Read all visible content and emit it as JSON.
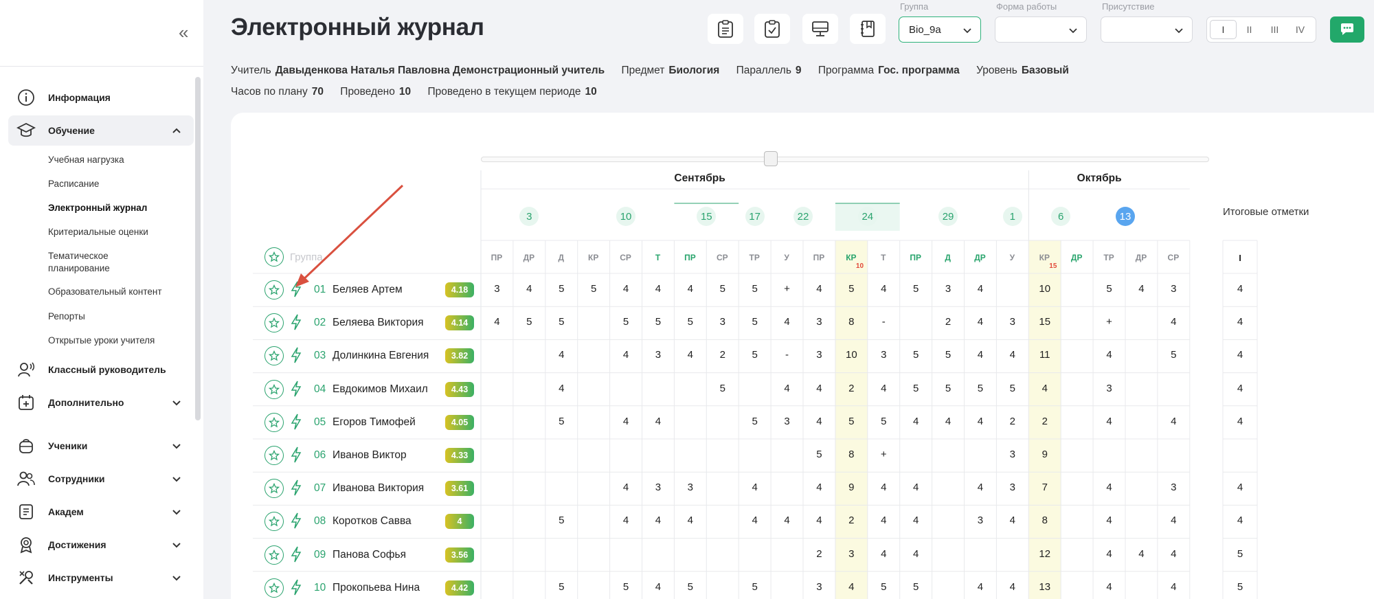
{
  "sidebar": {
    "items": [
      {
        "id": "info",
        "label": "Информация",
        "icon": "info-circle-icon",
        "expandable": false
      },
      {
        "id": "learning",
        "label": "Обучение",
        "icon": "graduation-cap-icon",
        "expandable": true,
        "expanded": true
      },
      {
        "id": "class-teacher",
        "label": "Классный руководитель",
        "icon": "person-voice-icon",
        "expandable": false
      },
      {
        "id": "extra",
        "label": "Дополнительно",
        "icon": "calendar-plus-icon",
        "expandable": true
      },
      {
        "id": "students",
        "label": "Ученики",
        "icon": "backpack-icon",
        "expandable": true
      },
      {
        "id": "staff",
        "label": "Сотрудники",
        "icon": "people-icon",
        "expandable": true
      },
      {
        "id": "academ",
        "label": "Академ",
        "icon": "document-list-icon",
        "expandable": true
      },
      {
        "id": "achievements",
        "label": "Достижения",
        "icon": "medal-icon",
        "expandable": true
      },
      {
        "id": "tools",
        "label": "Инструменты",
        "icon": "tools-icon",
        "expandable": true
      }
    ],
    "sub_items": [
      {
        "label": "Учебная нагрузка",
        "active": false
      },
      {
        "label": "Расписание",
        "active": false
      },
      {
        "label": "Электронный журнал",
        "active": true
      },
      {
        "label": "Критериальные оценки",
        "active": false
      },
      {
        "label": "Тематическое\nпланирование",
        "active": false
      },
      {
        "label": "Образовательный контент",
        "active": false
      },
      {
        "label": "Репорты",
        "active": false
      },
      {
        "label": "Открытые уроки учителя",
        "active": false
      }
    ]
  },
  "header": {
    "title": "Электронный журнал",
    "tools": [
      "clipboard-list-icon",
      "clipboard-check-icon",
      "monitor-icon",
      "notebook-icon"
    ],
    "filters": {
      "group": {
        "label": "Группа",
        "value": "Bio_9a"
      },
      "work_form": {
        "label": "Форма работы",
        "value": ""
      },
      "presence": {
        "label": "Присутствие",
        "value": ""
      }
    },
    "periods": [
      "I",
      "II",
      "III",
      "IV"
    ],
    "active_period": "I",
    "chat_icon": "chat-icon"
  },
  "info": {
    "line1": [
      {
        "k": "Учитель",
        "v": "Давыденкова Наталья Павловна Демонстрационный учитель"
      },
      {
        "k": "Предмет",
        "v": "Биология"
      },
      {
        "k": "Параллель",
        "v": "9"
      },
      {
        "k": "Программа",
        "v": "Гос. программа"
      },
      {
        "k": "Уровень",
        "v": "Базовый"
      }
    ],
    "line2": [
      {
        "k": "Часов по плану",
        "v": "70"
      },
      {
        "k": "Проведено",
        "v": "10"
      },
      {
        "k": "Проведено в текущем периоде",
        "v": "10"
      }
    ]
  },
  "journal": {
    "group_placeholder": "Группа",
    "months": [
      {
        "name": "Сентябрь"
      },
      {
        "name": "Октябрь"
      }
    ],
    "final_title": "Итоговые отметки",
    "final_col": "I",
    "days": [
      {
        "d": "3",
        "span": 3
      },
      {
        "d": "10",
        "span": 3
      },
      {
        "d": "15",
        "span": 2
      },
      {
        "d": "17",
        "span": 1
      },
      {
        "d": "22",
        "span": 2
      },
      {
        "d": "24",
        "span": 2
      },
      {
        "d": "29",
        "span": 3
      },
      {
        "d": "1",
        "span": 1
      },
      {
        "d": "6",
        "span": 2
      },
      {
        "d": "13",
        "span": 2
      }
    ],
    "columns": [
      {
        "h": "ПР",
        "g": false
      },
      {
        "h": "ДР",
        "g": false
      },
      {
        "h": "Д",
        "g": false
      },
      {
        "h": "КР",
        "g": false
      },
      {
        "h": "СР",
        "g": false
      },
      {
        "h": "Т",
        "g": true
      },
      {
        "h": "ПР",
        "g": true
      },
      {
        "h": "СР",
        "g": false
      },
      {
        "h": "ТР",
        "g": false
      },
      {
        "h": "У",
        "g": false
      },
      {
        "h": "ПР",
        "g": false
      },
      {
        "h": "КР",
        "g": true,
        "sub": "10"
      },
      {
        "h": "Т",
        "g": false
      },
      {
        "h": "ПР",
        "g": true
      },
      {
        "h": "Д",
        "g": true
      },
      {
        "h": "ДР",
        "g": true
      },
      {
        "h": "У",
        "g": false
      },
      {
        "h": "КР",
        "g": false,
        "sub": "15"
      },
      {
        "h": "ДР",
        "g": true
      },
      {
        "h": "ТР",
        "g": false
      },
      {
        "h": "ДР",
        "g": false
      },
      {
        "h": "СР",
        "g": false
      }
    ],
    "students": [
      {
        "n": "01",
        "name": "Беляев Артем",
        "avg": "4.18",
        "final": "4",
        "g": [
          "3",
          "4",
          "5",
          "5",
          "4",
          "4",
          "4",
          "5",
          "5",
          "+",
          "4",
          "5",
          "4",
          "5",
          "3",
          "4",
          "",
          "10",
          "",
          "5",
          "4",
          "3"
        ]
      },
      {
        "n": "02",
        "name": "Беляева Виктория",
        "avg": "4.14",
        "final": "4",
        "g": [
          "4",
          "5",
          "5",
          "",
          "5",
          "5",
          "5",
          "3",
          "5",
          "4",
          "3",
          "8",
          "-",
          "",
          "2",
          "4",
          "3",
          "15",
          "",
          "+",
          "",
          "4"
        ]
      },
      {
        "n": "03",
        "name": "Долинкина Евгения",
        "avg": "3.82",
        "final": "4",
        "g": [
          "",
          "",
          "4",
          "",
          "4",
          "3",
          "4",
          "2",
          "5",
          "-",
          "3",
          "10",
          "3",
          "5",
          "5",
          "4",
          "4",
          "11",
          "",
          "4",
          "",
          "5"
        ]
      },
      {
        "n": "04",
        "name": "Евдокимов Михаил",
        "avg": "4.43",
        "final": "4",
        "g": [
          "",
          "",
          "4",
          "",
          "",
          "",
          "",
          "5",
          "",
          "4",
          "4",
          "2",
          "4",
          "5",
          "5",
          "5",
          "5",
          "4",
          "",
          "3",
          "",
          ""
        ]
      },
      {
        "n": "05",
        "name": "Егоров Тимофей",
        "avg": "4.05",
        "final": "4",
        "g": [
          "",
          "",
          "5",
          "",
          "4",
          "4",
          "",
          "",
          "5",
          "3",
          "4",
          "5",
          "5",
          "4",
          "4",
          "4",
          "2",
          "2",
          "",
          "4",
          "",
          "4"
        ]
      },
      {
        "n": "06",
        "name": "Иванов Виктор",
        "avg": "4.33",
        "final": "",
        "g": [
          "",
          "",
          "",
          "",
          "",
          "",
          "",
          "",
          "",
          "",
          "5",
          "8",
          "+",
          "",
          "",
          "",
          "3",
          "9",
          "",
          "",
          "",
          ""
        ]
      },
      {
        "n": "07",
        "name": "Иванова Виктория",
        "avg": "3.61",
        "final": "4",
        "g": [
          "",
          "",
          "",
          "",
          "4",
          "3",
          "3",
          "",
          "4",
          "",
          "4",
          "9",
          "4",
          "4",
          "",
          "4",
          "3",
          "7",
          "",
          "4",
          "",
          "3"
        ]
      },
      {
        "n": "08",
        "name": "Коротков Савва",
        "avg": "4",
        "final": "4",
        "g": [
          "",
          "",
          "5",
          "",
          "4",
          "4",
          "4",
          "",
          "4",
          "4",
          "4",
          "2",
          "4",
          "4",
          "",
          "3",
          "4",
          "8",
          "",
          "4",
          "",
          "4"
        ]
      },
      {
        "n": "09",
        "name": "Панова Софья",
        "avg": "3.56",
        "final": "5",
        "g": [
          "",
          "",
          "",
          "",
          "",
          "",
          "",
          "",
          "",
          "",
          "2",
          "3",
          "4",
          "4",
          "",
          "",
          "",
          "12",
          "",
          "4",
          "4",
          "4"
        ]
      },
      {
        "n": "10",
        "name": "Прокопьева Нина",
        "avg": "4.42",
        "final": "5",
        "g": [
          "",
          "",
          "5",
          "",
          "5",
          "4",
          "5",
          "",
          "5",
          "",
          "3",
          "4",
          "5",
          "5",
          "",
          "4",
          "4",
          "13",
          "",
          "4",
          "",
          "4"
        ]
      }
    ]
  }
}
